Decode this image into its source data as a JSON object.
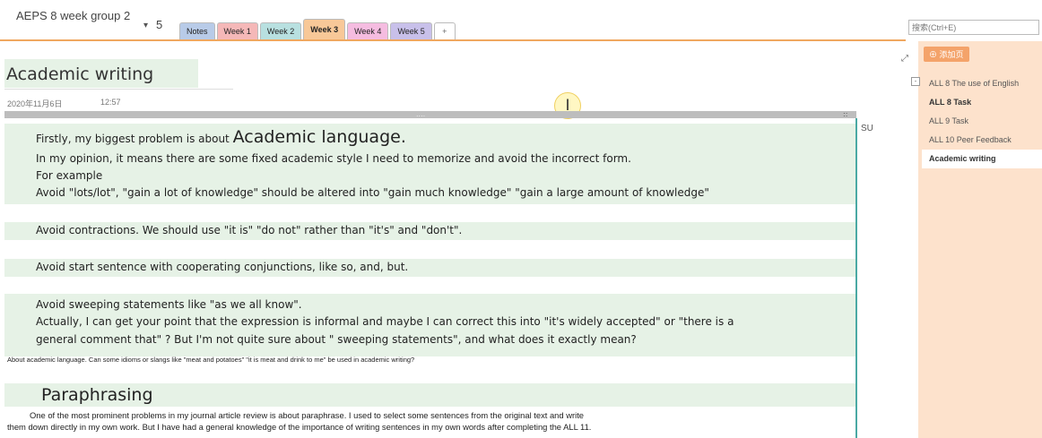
{
  "header": {
    "notebook_name": "AEPS 8 week group 2",
    "section_count": "5",
    "tabs": [
      {
        "label": "Notes",
        "color": "#b8cbe8"
      },
      {
        "label": "Week 1",
        "color": "#f5b8b8"
      },
      {
        "label": "Week 2",
        "color": "#b8e0e0"
      },
      {
        "label": "Week 3",
        "color": "#f8c898"
      },
      {
        "label": "Week 4",
        "color": "#f5bce0"
      },
      {
        "label": "Week 5",
        "color": "#c8c0ea"
      }
    ],
    "add_tab": "+",
    "search_placeholder": "搜索(Ctrl+E)"
  },
  "sidebar": {
    "add_page_label": "添加页",
    "collapse": "-",
    "pages": [
      {
        "label": "ALL 8 The use of English"
      },
      {
        "label": "ALL 8 Task"
      },
      {
        "label": "ALL 9 Task"
      },
      {
        "label": "ALL 10 Peer Feedback"
      },
      {
        "label": "Academic writing"
      }
    ]
  },
  "page": {
    "title": "Academic writing",
    "date": "2020年11月6日",
    "time": "12:57",
    "cursor_glyph": "I",
    "expand_glyph": "⤢",
    "bar_grip": "....",
    "bar_grip_right": "::",
    "side_label": "SU",
    "lines": {
      "l1_prefix": "Firstly, my biggest problem is about ",
      "l1_big": "Academic language.",
      "l2": "In my opinion, it means there are some fixed academic style I need to memorize and avoid the incorrect form.",
      "l3": "For example",
      "l4": "Avoid \"lots/lot\",  \"gain a lot of knowledge\" should be altered into \"gain much knowledge\" \"gain a large amount of knowledge\"",
      "l5": "Avoid contractions. We should use \"it is\" \"do not\" rather than \"it's\" and \"don't\".",
      "l6": "Avoid start sentence with cooperating conjunctions, like so, and, but.",
      "l7": "Avoid sweeping statements like \"as we all know\".",
      "l8": "Actually, I can get your point that the expression is informal and maybe I can correct this into \"it's widely accepted\" or \"there is a",
      "l9": "general comment that\" ? But I'm not quite sure about \" sweeping statements\", and what does it exactly mean?",
      "note": "About academic language. Can some idioms or slangs like \"meat and potatoes\" \"it is meat and drink to me\" be used in academic writing?",
      "heading2": "Paraphrasing",
      "body1": "One of the most prominent  problems in my journal article review is about paraphrase. I used to select some sentences from the original text and write",
      "body2": "them down directly in my own work. But I have had a general knowledge of the importance of writing sentences in my own words after completing the ALL 11."
    }
  }
}
